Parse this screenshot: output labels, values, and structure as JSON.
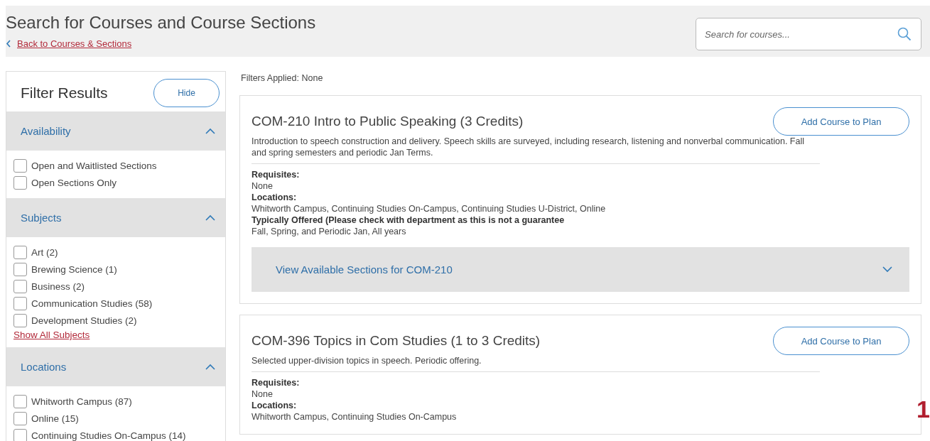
{
  "header": {
    "title": "Search for Courses and Course Sections",
    "back_link": "Back to Courses & Sections",
    "search": {
      "placeholder": "Search for courses..."
    }
  },
  "filters": {
    "title": "Filter Results",
    "hide_button": "Hide",
    "sections": [
      {
        "title": "Availability",
        "expanded": true,
        "options": [
          {
            "label": "Open and Waitlisted Sections",
            "checked": false
          },
          {
            "label": "Open Sections Only",
            "checked": false
          }
        ]
      },
      {
        "title": "Subjects",
        "expanded": true,
        "options": [
          {
            "label": "Art (2)",
            "checked": false
          },
          {
            "label": "Brewing Science (1)",
            "checked": false
          },
          {
            "label": "Business (2)",
            "checked": false
          },
          {
            "label": "Communication Studies (58)",
            "checked": false
          },
          {
            "label": "Development Studies (2)",
            "checked": false
          }
        ],
        "show_all_link": "Show All Subjects"
      },
      {
        "title": "Locations",
        "expanded": true,
        "options": [
          {
            "label": "Whitworth Campus (87)",
            "checked": false
          },
          {
            "label": "Online (15)",
            "checked": false
          },
          {
            "label": "Continuing Studies On-Campus (14)",
            "checked": false
          }
        ]
      }
    ]
  },
  "filters_applied": "Filters Applied: None",
  "courses": [
    {
      "title": "COM-210 Intro to Public Speaking (3 Credits)",
      "add_button": "Add Course to Plan",
      "description": "Introduction to speech construction and delivery. Speech skills are surveyed, including research, listening and nonverbal communication. Fall and spring semesters and periodic Jan Terms.",
      "details": [
        {
          "label": "Requisites:",
          "value": "None"
        },
        {
          "label": "Locations:",
          "value": "Whitworth Campus, Continuing Studies On-Campus, Continuing Studies U-District, Online"
        },
        {
          "label": "Typically Offered (Please check with department as this is not a guarantee",
          "value": "Fall, Spring, and Periodic Jan, All years"
        }
      ],
      "sections_toggle": {
        "label": "View Available Sections for COM-210",
        "expanded": false
      }
    },
    {
      "title": "COM-396 Topics in Com Studies (1 to 3 Credits)",
      "add_button": "Add Course to Plan",
      "description": "Selected upper-division topics in speech. Periodic offering.",
      "details": [
        {
          "label": "Requisites:",
          "value": "None"
        },
        {
          "label": "Locations:",
          "value": "Whitworth Campus, Continuing Studies On-Campus"
        }
      ]
    }
  ],
  "step_marker": "1"
}
